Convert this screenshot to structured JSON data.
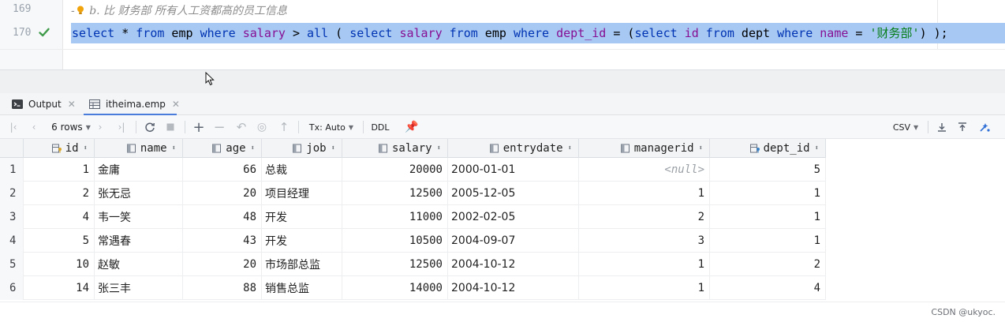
{
  "editor": {
    "line169": {
      "number": "169",
      "comment_prefix": "-",
      "comment_text": "b. 比 财务部 所有人工资都高的员工信息"
    },
    "line170": {
      "number": "170",
      "tokens": [
        {
          "t": "select",
          "c": "kw"
        },
        {
          "t": " * ",
          "c": ""
        },
        {
          "t": "from",
          "c": "kw"
        },
        {
          "t": " emp ",
          "c": ""
        },
        {
          "t": "where",
          "c": "kw"
        },
        {
          "t": " ",
          "c": ""
        },
        {
          "t": "salary",
          "c": "col"
        },
        {
          "t": " > ",
          "c": ""
        },
        {
          "t": "all",
          "c": "kw"
        },
        {
          "t": " ( ",
          "c": ""
        },
        {
          "t": "select",
          "c": "kw"
        },
        {
          "t": " ",
          "c": ""
        },
        {
          "t": "salary",
          "c": "col"
        },
        {
          "t": " ",
          "c": ""
        },
        {
          "t": "from",
          "c": "kw"
        },
        {
          "t": " emp ",
          "c": ""
        },
        {
          "t": "where",
          "c": "kw"
        },
        {
          "t": " ",
          "c": ""
        },
        {
          "t": "dept_id",
          "c": "col"
        },
        {
          "t": " = (",
          "c": ""
        },
        {
          "t": "select",
          "c": "kw"
        },
        {
          "t": " ",
          "c": ""
        },
        {
          "t": "id",
          "c": "col"
        },
        {
          "t": " ",
          "c": ""
        },
        {
          "t": "from",
          "c": "kw"
        },
        {
          "t": " dept ",
          "c": ""
        },
        {
          "t": "where",
          "c": "kw"
        },
        {
          "t": " ",
          "c": ""
        },
        {
          "t": "name",
          "c": "col"
        },
        {
          "t": " = ",
          "c": ""
        },
        {
          "t": "'财务部'",
          "c": "str"
        },
        {
          "t": ") );",
          "c": ""
        }
      ]
    }
  },
  "tabs": {
    "output": {
      "label": "Output",
      "icon": "output-console-icon"
    },
    "emp": {
      "label": "itheima.emp",
      "icon": "table-icon"
    }
  },
  "toolbar": {
    "rows_label": "6 rows",
    "tx_label": "Tx: Auto",
    "ddl_label": "DDL",
    "csv_label": "CSV"
  },
  "grid": {
    "columns": [
      {
        "name": "id",
        "icon": "key-column-icon"
      },
      {
        "name": "name",
        "icon": "column-icon"
      },
      {
        "name": "age",
        "icon": "column-icon"
      },
      {
        "name": "job",
        "icon": "column-icon"
      },
      {
        "name": "salary",
        "icon": "column-icon"
      },
      {
        "name": "entrydate",
        "icon": "column-icon"
      },
      {
        "name": "managerid",
        "icon": "column-icon"
      },
      {
        "name": "dept_id",
        "icon": "foreign-key-column-icon"
      }
    ],
    "rows": [
      {
        "idx": "1",
        "id": "1",
        "name": "金庸",
        "age": "66",
        "job": "总裁",
        "salary": "20000",
        "entrydate": "2000-01-01",
        "managerid": "<null>",
        "dept_id": "5"
      },
      {
        "idx": "2",
        "id": "2",
        "name": "张无忌",
        "age": "20",
        "job": "项目经理",
        "salary": "12500",
        "entrydate": "2005-12-05",
        "managerid": "1",
        "dept_id": "1"
      },
      {
        "idx": "3",
        "id": "4",
        "name": "韦一笑",
        "age": "48",
        "job": "开发",
        "salary": "11000",
        "entrydate": "2002-02-05",
        "managerid": "2",
        "dept_id": "1"
      },
      {
        "idx": "4",
        "id": "5",
        "name": "常遇春",
        "age": "43",
        "job": "开发",
        "salary": "10500",
        "entrydate": "2004-09-07",
        "managerid": "3",
        "dept_id": "1"
      },
      {
        "idx": "5",
        "id": "10",
        "name": "赵敏",
        "age": "20",
        "job": "市场部总监",
        "salary": "12500",
        "entrydate": "2004-10-12",
        "managerid": "1",
        "dept_id": "2"
      },
      {
        "idx": "6",
        "id": "14",
        "name": "张三丰",
        "age": "88",
        "job": "销售总监",
        "salary": "14000",
        "entrydate": "2004-10-12",
        "managerid": "1",
        "dept_id": "4"
      }
    ]
  },
  "watermark": "CSDN @ukyoc.",
  "colors": {
    "selection": "#a6c8f2",
    "keyword": "#0033b3",
    "column": "#871094",
    "string": "#067d17",
    "accent": "#4a7cdc"
  }
}
